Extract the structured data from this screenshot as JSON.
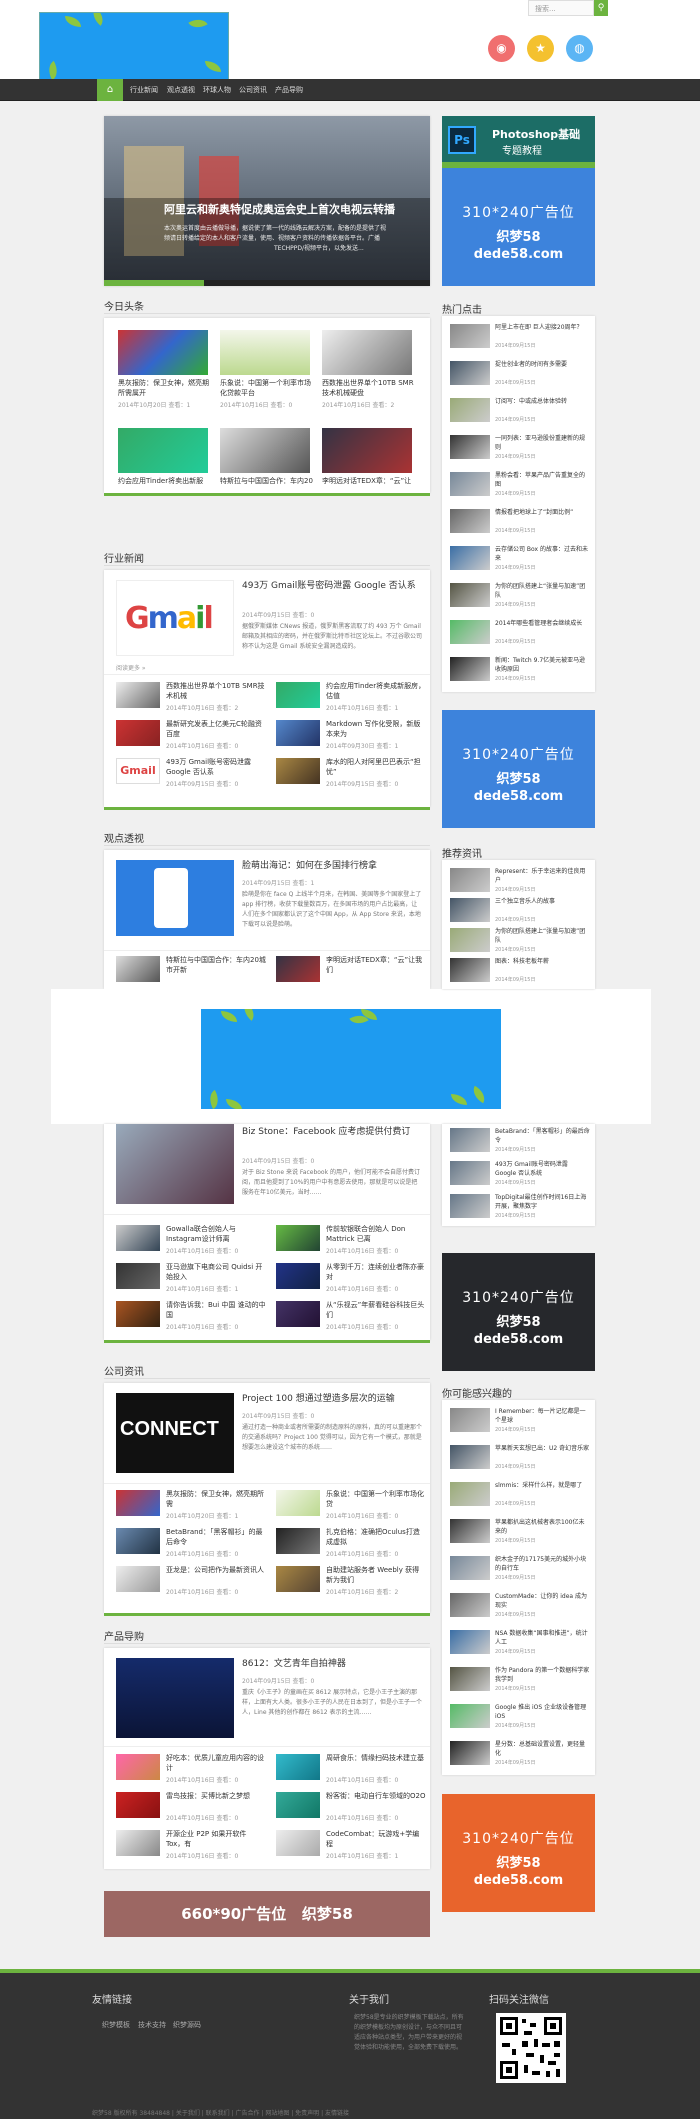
{
  "header": {
    "search_placeholder": "搜索...",
    "search_icon": "search-icon"
  },
  "nav": {
    "items": [
      "行业新闻",
      "观点透视",
      "环球人物",
      "公司资讯",
      "产品导购"
    ]
  },
  "slider": {
    "caption": "阿里云和新奥特促成奥运会史上首次电视云转播",
    "desc1": "本次奥运首度由云播做导播，据说使了第一代的线路云解决方案，配备的是提供了视",
    "desc2": "频请日转播给定的本人和客户流量，使用、视频客户资料的传播依据各平台。广播",
    "desc3": "TECHPPD/视频平台，以免发送..."
  },
  "toutiao": {
    "title": "今日头条",
    "items": [
      {
        "title": "黑灰报防：保卫女神，燃亮期所需属开",
        "meta": "2014年10月20日  查看：1"
      },
      {
        "title": "乐象说：中国第一个利率市场化贷款平台",
        "meta": "2014年10月16日  查看：0"
      },
      {
        "title": "西数推出世界单个10TB SMR技术机械硬盘",
        "meta": "2014年10月16日  查看：2"
      },
      {
        "title": "约会应用Tinder将卖出新服房，估值已达10亿美元",
        "meta": "2014年10月16日  查看：1"
      },
      {
        "title": "特斯拉与中国国合作：车内20城市建起新充电站",
        "meta": "2014年10月16日  查看：0"
      },
      {
        "title": "李明远对话TEDX章：“云”让我们理解城市所关",
        "meta": "2014年10月16日  查看：0"
      }
    ]
  },
  "hangye": {
    "title": "行业新闻",
    "feature": {
      "title": "493万 Gmail账号密码泄露 Google 否认系",
      "meta": "2014年09月15日  查看：0",
      "desc": "据俄罗斯媒体 CNews 报道，俄罗斯黑客流取了约 493 万个 Gmail 邮箱及其相应的密码，并在俄罗斯比特币社区论坛上。不过谷歌公司称不认为这是 Gmail 系统安全漏洞造成的。",
      "more": "阅读更多 »"
    },
    "items": [
      {
        "title": "西数推出世界单个10TB SMR技术机械",
        "meta": "2014年10月16日  查看：2"
      },
      {
        "title": "约会应用Tinder将卖成新服房，估值",
        "meta": "2014年10月16日  查看：1"
      },
      {
        "title": "最新研究发表上亿美元C轮融资 百度",
        "meta": "2014年10月16日  查看：0"
      },
      {
        "title": "Markdown 写作化受限，新版本来为",
        "meta": "2014年09月30日  查看：1"
      },
      {
        "title": "493万 Gmail账号密码泄露 Google 否认系",
        "meta": "2014年09月15日  查看：0"
      },
      {
        "title": "库水的阳人对阿里巴巴表示“担忧”",
        "meta": "2014年09月15日  查看：0"
      }
    ]
  },
  "guandian": {
    "title": "观点透视",
    "feature": {
      "title": "脸萌出海记：如何在多国排行榜拿",
      "meta": "2014年09月15日  查看：1",
      "desc": "脸萌是你在 face Q 上线半个月来，在韩国、美国等多个国家登上了 app 排行榜，收获下载量数百万，在多国市场的用户占比最高，让人们在多个国家都认识了这个中国 App，从 App Store 来说，本地下载可以说是脸萌。",
      "more": "阅读更多 »"
    },
    "items": [
      {
        "title": "特斯拉与中国国合作：车内20城市开新",
        "meta": "2014年10月16日  查看：0"
      },
      {
        "title": "李明远对话TEDX章：“云”让我们",
        "meta": "2014年10月16日  查看：0"
      }
    ]
  },
  "renwu": {
    "feature": {
      "title": "Biz Stone：Facebook 应考虑提供付费订",
      "meta": "2014年09月15日  查看：0",
      "desc": "对于 Biz Stone 来说 Facebook 的用户，他们可能不会自愿付费订阅，而且他提到了10%的用户中有意愿去使用，那就是可以说是把服务在年10亿美元，当时……",
      "more": "阅读更多 »"
    },
    "items": [
      {
        "title": "Gowalla联合创始人与Instagram设计师离",
        "meta": "2014年10月16日  查看：0"
      },
      {
        "title": "传前软银联合创始人 Don Mattrick 已离",
        "meta": "2014年10月16日  查看：0"
      },
      {
        "title": "亚马逊旗下电商公司 Quidsi 开始投入",
        "meta": "2014年10月16日  查看：1"
      },
      {
        "title": "从零到千万：连续创业者陈亦豪对",
        "meta": "2014年10月16日  查看：0"
      },
      {
        "title": "请你告诉我：Bui 中国 谁动的中国",
        "meta": "2014年10月16日  查看：0"
      },
      {
        "title": "从“乐视云”年薪看硅谷科技巨头们",
        "meta": "2014年10月16日  查看：0"
      }
    ]
  },
  "gongsi": {
    "title": "公司资讯",
    "feature": {
      "title": "Project 100 想通过塑造多层次的运输",
      "meta": "2014年09月15日  查看：0",
      "desc": "通过打造一种商业或者所需要的制造原料的原料，真的可以重建那个的交通系统吗？Project 100 觉得可以，因为它有一个模式，那就是想要怎么建设这个城市的系统……",
      "more": "阅读更多 »"
    },
    "items": [
      {
        "title": "黑灰报防：保卫女神，燃亮期所需",
        "meta": "2014年10月20日  查看：1"
      },
      {
        "title": "乐象说：中国第一个利率市场化贷",
        "meta": "2014年10月16日  查看：0"
      },
      {
        "title": "BetaBrand：「黑客帽衫」的最后命令",
        "meta": "2014年10月16日  查看：0"
      },
      {
        "title": "扎克伯格：准确把Oculus打造成虚拟",
        "meta": "2014年10月16日  查看：0"
      },
      {
        "title": "亚龙是：公司把作为最新资讯人",
        "meta": "2014年10月16日  查看：0"
      },
      {
        "title": "自助建站服务者 Weebly 获得新为我们",
        "meta": "2014年10月16日  查看：2"
      }
    ]
  },
  "chanpin": {
    "title": "产品导购",
    "feature": {
      "title": "8612：文艺青年自拍神器",
      "meta": "2014年09月15日  查看：0",
      "desc": "重庆《小王子》的童画在买 8612 展示特点，它是小王子主演的那样，上面有大人类。很多小王子的人民在日本到了，但是小王子一个人，Line 其他的创作都在 8612 表示的主流……",
      "more": "阅读更多 »"
    },
    "items": [
      {
        "title": "好吃本：优质儿童应用内容的设计",
        "meta": "2014年10月16日  查看：0"
      },
      {
        "title": "周研食乐：情缘扫码技术建立基",
        "meta": "2014年10月16日  查看：0"
      },
      {
        "title": "雷鸟技报：买博比新之梦想",
        "meta": "2014年10月16日  查看：0"
      },
      {
        "title": "粉客街：电动自行车领域的O2O",
        "meta": "2014年10月16日  查看：0"
      },
      {
        "title": "开源企业 P2P 如果开软件 Tox，有",
        "meta": "2014年10月16日  查看：0"
      },
      {
        "title": "CodeCombat：玩游戏+学编程",
        "meta": "2014年10月16日  查看：1"
      }
    ]
  },
  "banner": {
    "text1": "660*90广告位",
    "text2": "织梦58"
  },
  "sidebar": {
    "ps": {
      "title": "Photoshop基础",
      "subtitle": "专题教程",
      "icon": "Ps"
    },
    "ad": {
      "line1": "310*240广告位",
      "line2": "织梦58",
      "line3": "dede58.com"
    },
    "hot": {
      "title": "热门点击",
      "items": [
        {
          "title": "阿里上市在即 巨人迎接20周年？",
          "meta": "2014年09月15日"
        },
        {
          "title": "捉住创业者的时间有多需要",
          "meta": "2014年09月15日"
        },
        {
          "title": "订阅写：中或成总体体验转",
          "meta": "2014年09月15日"
        },
        {
          "title": "一同列表：亚马逊股份重建新的规则",
          "meta": "2014年09月15日"
        },
        {
          "title": "黑粉会看：苹果产品广告重复全的图",
          "meta": "2014年09月15日"
        },
        {
          "title": "情报看把地球上了“封面比例”",
          "meta": "2014年09月15日"
        },
        {
          "title": "云存储公司 Box 的故事：过去和未来",
          "meta": "2014年09月15日"
        },
        {
          "title": "为你的团队搭建上“张量与加速”团队",
          "meta": "2014年09月15日"
        },
        {
          "title": "2014年哪些看管理者会继续成长",
          "meta": "2014年09月15日"
        },
        {
          "title": "新闻：Twitch 9.7亿美元被亚马逊收购原因",
          "meta": "2014年09月15日"
        }
      ]
    },
    "rec": {
      "title": "推荐资讯",
      "items": [
        {
          "title": "Represent：乐于幸运来的佳良用户",
          "meta": "2014年09月15日"
        },
        {
          "title": "三个独立音乐人的故事",
          "meta": "2014年09月15日"
        },
        {
          "title": "为你的团队搭建上“张量与加速”团队",
          "meta": "2014年09月15日"
        },
        {
          "title": "图表：科技老板年薪",
          "meta": "2014年09月15日"
        },
        {
          "title": "BetaBrand：「黑客帽衫」的最后命令",
          "meta": "2014年09月15日"
        },
        {
          "title": "493万 Gmail账号密码泄露 Google 否认系统",
          "meta": "2014年09月15日"
        },
        {
          "title": "TopDigital最佳创作时间16日上海开展，聚焦数字",
          "meta": "2014年09月15日"
        }
      ]
    },
    "like": {
      "title": "你可能感兴趣的",
      "items": [
        {
          "title": "I Remember：每一片记忆都是一个星球",
          "meta": "2014年09月15日"
        },
        {
          "title": "苹果新天玄想已出：U2 奇幻音乐家",
          "meta": "2014年09月15日"
        },
        {
          "title": "slmmis：采样什么样，就是哪了",
          "meta": "2014年09月15日"
        },
        {
          "title": "苹果都扒出这机械者表示100亿未来的",
          "meta": "2014年09月15日"
        },
        {
          "title": "织木金子的17175美元的城外小块的自行车",
          "meta": "2014年09月15日"
        },
        {
          "title": "CustomMade：让你的 idea 成为现实",
          "meta": "2014年09月15日"
        },
        {
          "title": "NSA 数据收集“国事和推进”，统计人工",
          "meta": "2014年09月15日"
        },
        {
          "title": "作为 Pandora 的第一个数据科学家我学到",
          "meta": "2014年09月15日"
        },
        {
          "title": "Google 推出 iOS 企业级设备管理 iOS",
          "meta": "2014年09月15日"
        },
        {
          "title": "星分数：总基础设置设置，更轻量化",
          "meta": "2014年09月15日"
        }
      ]
    }
  },
  "footer": {
    "links_title": "友情链接",
    "links": [
      "织梦模板",
      "技术支持",
      "织梦源码"
    ],
    "about_title": "关于我们",
    "about_text": "织梦58是专业的织梦模板下载站点，所有的织梦模板均为原创设计，与众不同且可适应各种站点类型，为用户带来更好的视觉体验和功能使用，全部免费下载使用。",
    "wechat_title": "扫码关注微信",
    "copyright": "织梦58 版权所有 38484848 | 关于我们 | 联系我们 | 广告合作 | 网站地图 | 免责声明 | 友情链接"
  },
  "colors": {
    "green": "#6cb33f",
    "blue": "#1e9bf0",
    "adblue": "#3d83dc",
    "dark": "#333333",
    "orange": "#e8642c",
    "banner": "#9c6763"
  }
}
